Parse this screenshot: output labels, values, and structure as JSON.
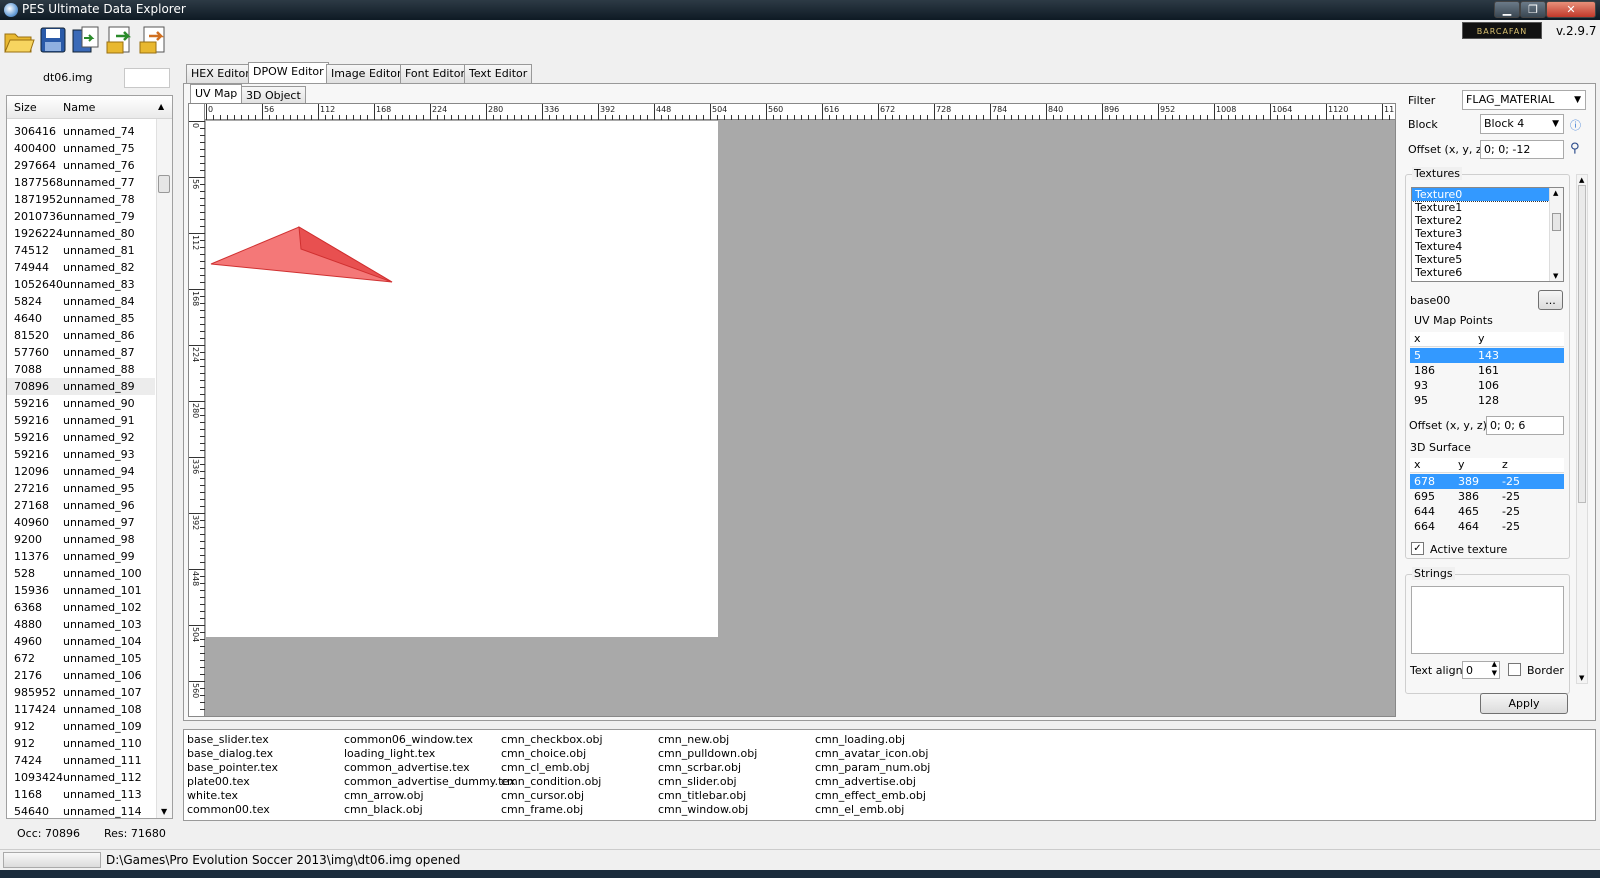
{
  "window": {
    "title": "PES Ultimate Data Explorer",
    "version": "v.2.9.7",
    "logo_text": "BARCAFAN"
  },
  "controls": {
    "minimize": "▁",
    "maximize": "❐",
    "close": "✕"
  },
  "toolbar": [
    "open-folder-icon",
    "save-icon",
    "import-icon",
    "export-icon",
    "export-all-icon"
  ],
  "left_panel": {
    "file_label": "dt06.img",
    "search_value": "",
    "columns": {
      "size": "Size",
      "name": "Name"
    },
    "files": [
      {
        "size": "306416",
        "name": "unnamed_74"
      },
      {
        "size": "400400",
        "name": "unnamed_75"
      },
      {
        "size": "297664",
        "name": "unnamed_76"
      },
      {
        "size": "1877568",
        "name": "unnamed_77"
      },
      {
        "size": "1871952",
        "name": "unnamed_78"
      },
      {
        "size": "2010736",
        "name": "unnamed_79"
      },
      {
        "size": "1926224",
        "name": "unnamed_80"
      },
      {
        "size": "74512",
        "name": "unnamed_81"
      },
      {
        "size": "74944",
        "name": "unnamed_82"
      },
      {
        "size": "1052640",
        "name": "unnamed_83"
      },
      {
        "size": "5824",
        "name": "unnamed_84"
      },
      {
        "size": "4640",
        "name": "unnamed_85"
      },
      {
        "size": "81520",
        "name": "unnamed_86"
      },
      {
        "size": "57760",
        "name": "unnamed_87"
      },
      {
        "size": "7088",
        "name": "unnamed_88"
      },
      {
        "size": "70896",
        "name": "unnamed_89"
      },
      {
        "size": "59216",
        "name": "unnamed_90"
      },
      {
        "size": "59216",
        "name": "unnamed_91"
      },
      {
        "size": "59216",
        "name": "unnamed_92"
      },
      {
        "size": "59216",
        "name": "unnamed_93"
      },
      {
        "size": "12096",
        "name": "unnamed_94"
      },
      {
        "size": "27216",
        "name": "unnamed_95"
      },
      {
        "size": "27168",
        "name": "unnamed_96"
      },
      {
        "size": "40960",
        "name": "unnamed_97"
      },
      {
        "size": "9200",
        "name": "unnamed_98"
      },
      {
        "size": "11376",
        "name": "unnamed_99"
      },
      {
        "size": "528",
        "name": "unnamed_100"
      },
      {
        "size": "15936",
        "name": "unnamed_101"
      },
      {
        "size": "6368",
        "name": "unnamed_102"
      },
      {
        "size": "4880",
        "name": "unnamed_103"
      },
      {
        "size": "4960",
        "name": "unnamed_104"
      },
      {
        "size": "672",
        "name": "unnamed_105"
      },
      {
        "size": "2176",
        "name": "unnamed_106"
      },
      {
        "size": "985952",
        "name": "unnamed_107"
      },
      {
        "size": "117424",
        "name": "unnamed_108"
      },
      {
        "size": "912",
        "name": "unnamed_109"
      },
      {
        "size": "912",
        "name": "unnamed_110"
      },
      {
        "size": "7424",
        "name": "unnamed_111"
      },
      {
        "size": "1093424",
        "name": "unnamed_112"
      },
      {
        "size": "1168",
        "name": "unnamed_113"
      },
      {
        "size": "54640",
        "name": "unnamed_114"
      }
    ],
    "occ": "Occ: 70896",
    "res": "Res: 71680"
  },
  "tabs": [
    "HEX Editor",
    "DPOW Editor",
    "Image  Editor",
    "Font Editor",
    "Text Editor"
  ],
  "subtabs": [
    "UV Map",
    "3D Object"
  ],
  "ruler_top": [
    "0",
    "56",
    "112",
    "168",
    "224",
    "280",
    "336",
    "392",
    "448",
    "504",
    "560",
    "616",
    "672",
    "728",
    "784",
    "840",
    "896",
    "952",
    "1008",
    "1064",
    "1120",
    "11"
  ],
  "ruler_left": [
    "0",
    "56",
    "112",
    "168",
    "224",
    "280",
    "336",
    "392",
    "448",
    "504",
    "560"
  ],
  "right_panel": {
    "filter_label": "Filter",
    "filter_value": "FLAG_MATERIAL",
    "block_label": "Block",
    "block_value": "Block 4",
    "offset_label": "Offset (x, y, z)",
    "offset_value": "0; 0; -12",
    "textures_label": "Textures",
    "textures": [
      "Texture0",
      "Texture1",
      "Texture2",
      "Texture3",
      "Texture4",
      "Texture5",
      "Texture6"
    ],
    "base_label": "base00",
    "browse_label": "...",
    "uv_points_label": "UV Map Points",
    "uv_headers": [
      "x",
      "y"
    ],
    "uv_points": [
      [
        "5",
        "143"
      ],
      [
        "186",
        "161"
      ],
      [
        "93",
        "106"
      ],
      [
        "95",
        "128"
      ]
    ],
    "offset2_label": "Offset (x, y, z)",
    "offset2_value": "0; 0; 6",
    "surface_label": "3D Surface",
    "surface_headers": [
      "x",
      "y",
      "z"
    ],
    "surface_points": [
      [
        "678",
        "389",
        "-25"
      ],
      [
        "695",
        "386",
        "-25"
      ],
      [
        "644",
        "465",
        "-25"
      ],
      [
        "664",
        "464",
        "-25"
      ]
    ],
    "active_texture_label": "Active texture",
    "strings_label": "Strings",
    "text_align_label": "Text align",
    "text_align_value": "0",
    "border_label": "Border",
    "apply_label": "Apply"
  },
  "texture_files": [
    [
      "base_slider.tex",
      "base_dialog.tex",
      "base_pointer.tex",
      "plate00.tex",
      "white.tex",
      "common00.tex"
    ],
    [
      "common06_window.tex",
      "loading_light.tex",
      "common_advertise.tex",
      "common_advertise_dummy.tex",
      "cmn_arrow.obj",
      "cmn_black.obj"
    ],
    [
      "cmn_checkbox.obj",
      "cmn_choice.obj",
      "cmn_cl_emb.obj",
      "cmn_condition.obj",
      "cmn_cursor.obj",
      "cmn_frame.obj"
    ],
    [
      "cmn_new.obj",
      "cmn_pulldown.obj",
      "cmn_scrbar.obj",
      "cmn_slider.obj",
      "cmn_titlebar.obj",
      "cmn_window.obj"
    ],
    [
      "cmn_loading.obj",
      "cmn_avatar_icon.obj",
      "cmn_param_num.obj",
      "cmn_advertise.obj",
      "cmn_effect_emb.obj",
      "cmn_el_emb.obj"
    ]
  ],
  "status": {
    "text": "D:\\Games\\Pro Evolution Soccer 2013\\img\\dt06.img opened"
  },
  "colors": {
    "selection": "#3399ff",
    "polygon_fill": "#f47878",
    "polygon_stroke": "#d03030",
    "canvas_bg": "#a9a9a9"
  }
}
